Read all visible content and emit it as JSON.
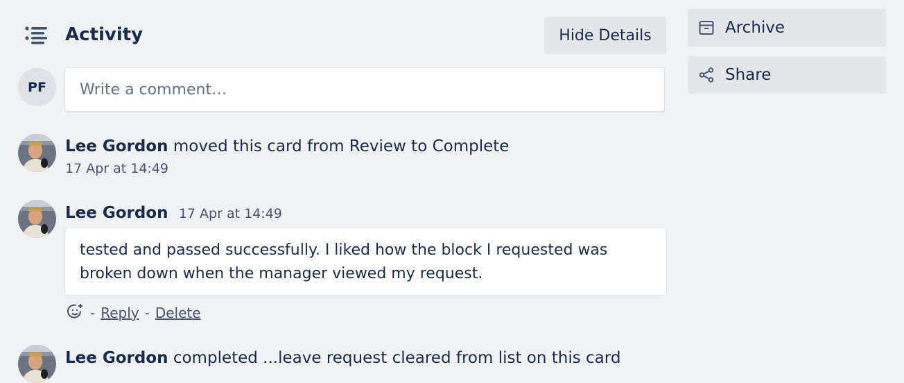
{
  "header": {
    "title": "Activity",
    "hide_details_label": "Hide Details"
  },
  "sidebar": {
    "archive_label": "Archive",
    "share_label": "Share"
  },
  "comment_composer": {
    "avatar_initials": "PF",
    "placeholder": "Write a comment…"
  },
  "activity": [
    {
      "author": "Lee Gordon",
      "action": "moved this card from Review to Complete",
      "timestamp": "17 Apr at 14:49"
    },
    {
      "author": "Lee Gordon",
      "timestamp": "17 Apr at 14:49",
      "comment": "tested and passed successfully. I liked how the block I requested was broken down when the manager viewed my request.",
      "separator": "-",
      "reply_label": "Reply",
      "delete_label": "Delete"
    },
    {
      "author": "Lee Gordon",
      "action": "completed ...leave request cleared from list on this card"
    }
  ],
  "icons": {
    "activity": "list-icon",
    "archive": "archive-box-icon",
    "share": "share-icon",
    "reaction": "add-reaction-icon"
  },
  "colors": {
    "background": "#f1f2f4",
    "button_bg": "#e4e6ea",
    "text": "#172b4d",
    "subtle_text": "#44546f"
  }
}
